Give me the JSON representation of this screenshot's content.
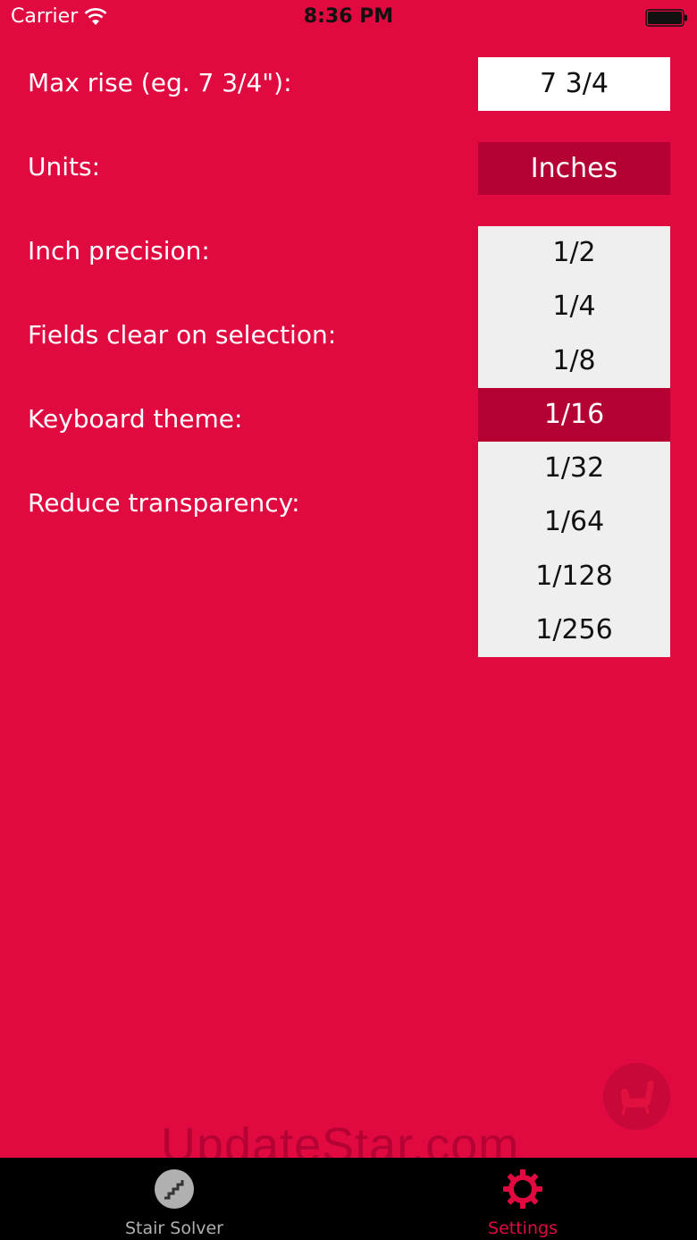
{
  "status_bar": {
    "carrier": "Carrier",
    "time": "8:36 PM"
  },
  "settings": {
    "max_rise_label": "Max rise (eg. 7 3/4\"):",
    "max_rise_value": "7 3/4",
    "units_label": "Units:",
    "units_value": "Inches",
    "inch_precision_label": "Inch precision:",
    "fields_clear_label": "Fields clear on selection:",
    "keyboard_theme_label": "Keyboard theme:",
    "reduce_transparency_label": "Reduce transparency:"
  },
  "precision_options": [
    "1/2",
    "1/4",
    "1/8",
    "1/16",
    "1/32",
    "1/64",
    "1/128",
    "1/256"
  ],
  "precision_selected": "1/16",
  "watermark": "UpdateStar.com",
  "tabs": [
    {
      "label": "Stair Solver",
      "icon": "stairs-icon",
      "active": false
    },
    {
      "label": "Settings",
      "icon": "gear-icon",
      "active": true
    }
  ],
  "colors": {
    "background": "#e00a40",
    "accent_dark": "#b50033",
    "active_tab": "#e00a40",
    "inactive_tab": "#b0b0b0"
  }
}
